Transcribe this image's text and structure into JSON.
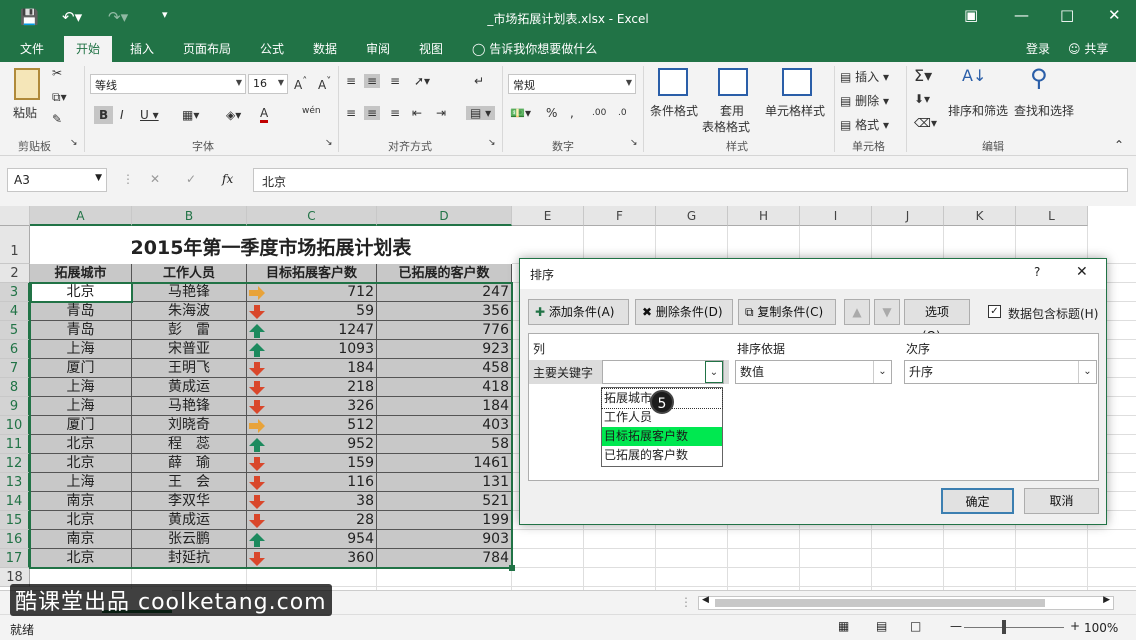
{
  "window": {
    "title": "_市场拓展计划表.xlsx - Excel"
  },
  "menu": {
    "tabs": [
      "文件",
      "开始",
      "插入",
      "页面布局",
      "公式",
      "数据",
      "审阅",
      "视图"
    ],
    "tell_me": "告诉我你想要做什么",
    "login": "登录",
    "share": "共享"
  },
  "ribbon": {
    "paste": "粘贴",
    "clipboard": "剪贴板",
    "font_name": "等线",
    "font_size": "16",
    "font_group": "字体",
    "align_group": "对齐方式",
    "number_format": "常规",
    "number_group": "数字",
    "cond_format": "条件格式",
    "table_format_1": "套用",
    "table_format_2": "表格格式",
    "cell_style": "单元格样式",
    "style_group": "样式",
    "insert": "插入",
    "delete": "删除",
    "format": "格式",
    "cells_group": "单元格",
    "sort_filter": "排序和筛选",
    "find_select": "查找和选择",
    "edit_group": "编辑"
  },
  "formula_bar": {
    "name_box": "A3",
    "value": "北京"
  },
  "sheet": {
    "columns": [
      "A",
      "B",
      "C",
      "D",
      "E",
      "F",
      "G",
      "H",
      "I",
      "J",
      "K",
      "L"
    ],
    "title": "2015年第一季度市场拓展计划表",
    "headers": [
      "拓展城市",
      "工作人员",
      "目标拓展客户数",
      "已拓展的客户数"
    ],
    "rows": [
      [
        "北京",
        "马艳锋",
        "712",
        "247",
        "right"
      ],
      [
        "青岛",
        "朱海波",
        "59",
        "356",
        "down"
      ],
      [
        "青岛",
        "彭　雷",
        "1247",
        "776",
        "up"
      ],
      [
        "上海",
        "宋普亚",
        "1093",
        "923",
        "up"
      ],
      [
        "厦门",
        "王明飞",
        "184",
        "458",
        "down"
      ],
      [
        "上海",
        "黄成运",
        "218",
        "418",
        "down"
      ],
      [
        "上海",
        "马艳锋",
        "326",
        "184",
        "down"
      ],
      [
        "厦门",
        "刘晓奇",
        "512",
        "403",
        "right"
      ],
      [
        "北京",
        "程　蕊",
        "952",
        "58",
        "up"
      ],
      [
        "北京",
        "薛　瑜",
        "159",
        "1461",
        "down"
      ],
      [
        "上海",
        "王　会",
        "116",
        "131",
        "down"
      ],
      [
        "南京",
        "李双华",
        "38",
        "521",
        "down"
      ],
      [
        "北京",
        "黄成运",
        "28",
        "199",
        "down"
      ],
      [
        "南京",
        "张云鹏",
        "954",
        "903",
        "up"
      ],
      [
        "北京",
        "封延抗",
        "360",
        "784",
        "down"
      ]
    ],
    "row_numbers": [
      "1",
      "2",
      "3",
      "4",
      "5",
      "6",
      "7",
      "8",
      "9",
      "10",
      "11",
      "12",
      "13",
      "14",
      "15",
      "16",
      "17",
      "18"
    ]
  },
  "dialog": {
    "title": "排序",
    "help": "?",
    "add": "添加条件(A)",
    "delete": "删除条件(D)",
    "copy": "复制条件(C)",
    "options": "选项(O)...",
    "has_header": "数据包含标题(H)",
    "col_header": "列",
    "sort_on_header": "排序依据",
    "order_header": "次序",
    "key_label": "主要关键字",
    "sort_on": "数值",
    "order": "升序",
    "dropdown_options": [
      "拓展城市",
      "工作人员",
      "目标拓展客户数",
      "已拓展的客户数"
    ],
    "highlighted_index": 2,
    "ok": "确定",
    "cancel": "取消"
  },
  "step_badge": "5",
  "status": {
    "ready": "就绪",
    "zoom": "100%"
  },
  "watermark": "酷课堂出品 coolketang.com",
  "colors": {
    "excel_green": "#217346",
    "highlight": "#00e850",
    "arrow_up": "#1d8a5e",
    "arrow_down": "#d9472b",
    "arrow_right": "#e8a33a"
  }
}
